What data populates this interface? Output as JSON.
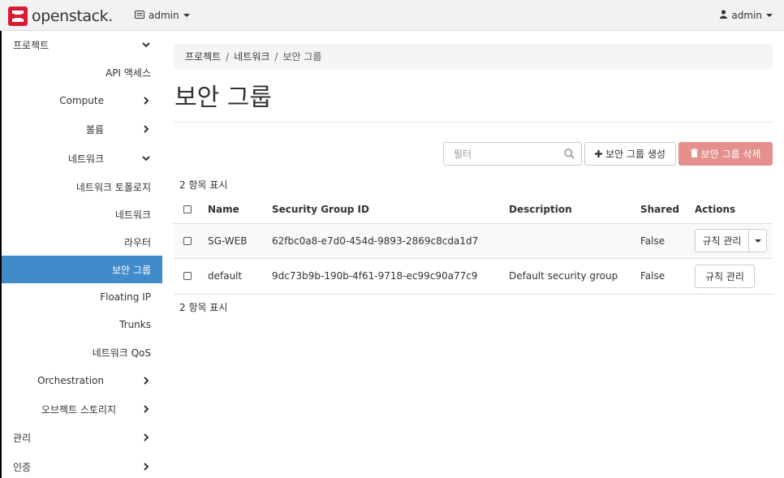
{
  "brand": {
    "name": "openstack",
    "dot": ".",
    "color": "#da1a32"
  },
  "header": {
    "project": "admin",
    "user": "admin"
  },
  "sidebar": {
    "items": [
      {
        "label": "프로젝트"
      },
      {
        "label": "API 액세스"
      },
      {
        "label": "Compute"
      },
      {
        "label": "볼륨"
      },
      {
        "label": "네트워크"
      },
      {
        "label": "네트워크 토폴로지"
      },
      {
        "label": "네트워크"
      },
      {
        "label": "라우터"
      },
      {
        "label": "보안 그룹"
      },
      {
        "label": "Floating IP"
      },
      {
        "label": "Trunks"
      },
      {
        "label": "네트워크 QoS"
      },
      {
        "label": "Orchestration"
      },
      {
        "label": "오브젝트 스토리지"
      },
      {
        "label": "관리"
      },
      {
        "label": "인증"
      }
    ],
    "active_color": "#428bca"
  },
  "breadcrumb": {
    "item1": "프로젝트",
    "item2": "네트워크",
    "current": "보안 그룹",
    "sep": "/"
  },
  "page": {
    "title": "보안 그룹"
  },
  "toolbar": {
    "filter_placeholder": "필터",
    "create_label": "보안 그룹 생성",
    "delete_label": "보안 그룹 삭제",
    "delete_color": "#e6908e"
  },
  "table": {
    "count_top": "2 항목 표시",
    "count_bottom": "2 항목 표시",
    "headers": {
      "name": "Name",
      "id": "Security Group ID",
      "description": "Description",
      "shared": "Shared",
      "actions": "Actions"
    },
    "rows": [
      {
        "name": "SG-WEB",
        "id": "62fbc0a8-e7d0-454d-9893-2869c8cda1d7",
        "description": "",
        "shared": "False",
        "action": "규칙 관리"
      },
      {
        "name": "default",
        "id": "9dc73b9b-190b-4f61-9718-ec99c90a77c9",
        "description": "Default security group",
        "shared": "False",
        "action": "규칙 관리"
      }
    ]
  }
}
